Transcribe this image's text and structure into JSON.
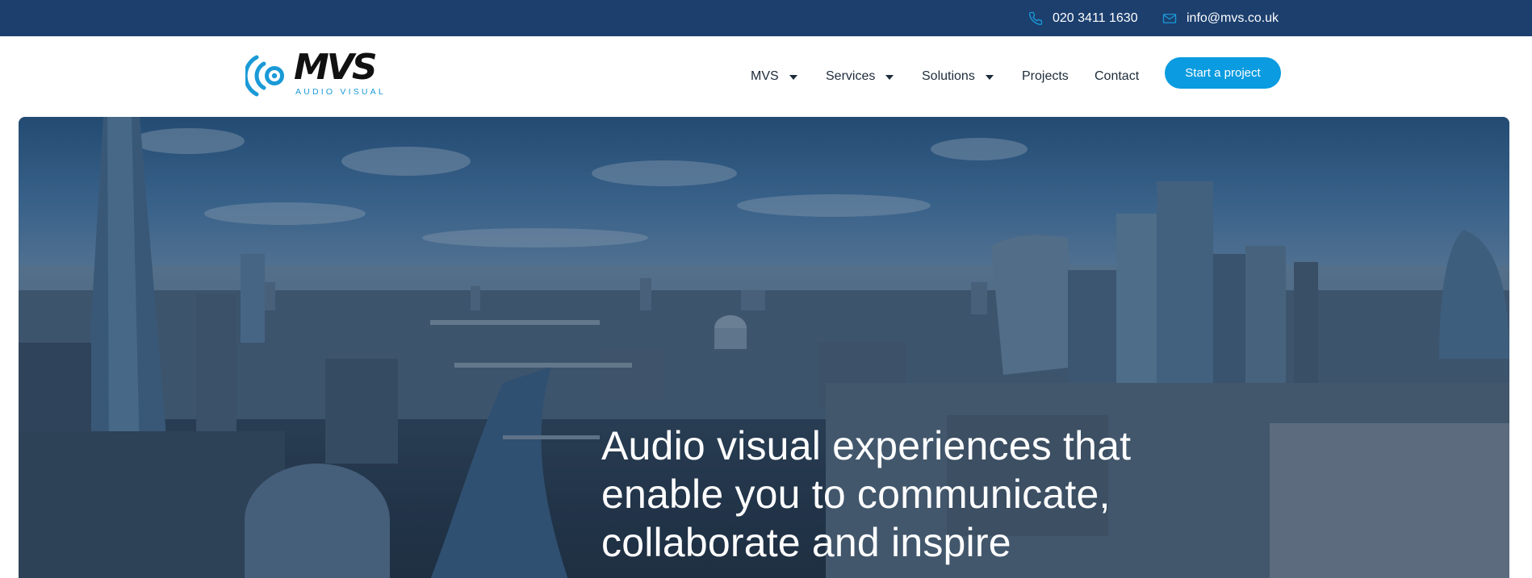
{
  "topbar": {
    "phone": "020 3411 1630",
    "email": "info@mvs.co.uk",
    "icons": {
      "phone": "phone-icon",
      "email": "mail-icon"
    }
  },
  "logo": {
    "wordmark": "MVS",
    "tagline": "AUDIO VISUAL"
  },
  "nav": {
    "items": [
      {
        "label": "MVS",
        "has_dropdown": true
      },
      {
        "label": "Services",
        "has_dropdown": true
      },
      {
        "label": "Solutions",
        "has_dropdown": true
      },
      {
        "label": "Projects",
        "has_dropdown": false
      },
      {
        "label": "Contact",
        "has_dropdown": false
      }
    ],
    "cta": "Start a project"
  },
  "hero": {
    "headline_lines": [
      "Audio visual experiences that",
      "enable you to communicate,",
      "collaborate and inspire"
    ]
  },
  "colors": {
    "topbar": "#1c3f6e",
    "accent": "#0a9be0",
    "nav_text": "#1d2b3a",
    "logo_blue": "#1a9ad7"
  }
}
